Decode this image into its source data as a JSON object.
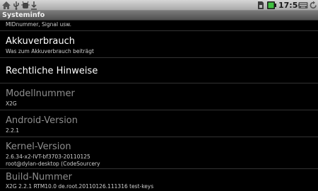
{
  "status_bar": {
    "time": "17:56",
    "icons": [
      "home-icon",
      "usb-icon",
      "usb-debugging-icon",
      "download-icon",
      "sim-icon",
      "battery-icon",
      "keyboard-icon",
      "rotate-icon"
    ]
  },
  "title_bar": {
    "title": "Systeminfo"
  },
  "items": [
    {
      "subtitle": "MIDnummer, Signal usw."
    },
    {
      "title": "Akkuverbrauch",
      "subtitle": "Was zum Akkuverbrauch beiträgt"
    },
    {
      "title": "Rechtliche Hinweise"
    },
    {
      "title": "Modellnummer",
      "subtitle": "X2G"
    },
    {
      "title": "Android-Version",
      "subtitle": "2.2.1"
    },
    {
      "title": "Kernel-Version",
      "subtitle": "2.6.34-x2-IVT-bf3703-20110125",
      "subtitle2": "root@dylan-desktop (CodeSourcery"
    },
    {
      "title": "Build-Nummer",
      "subtitle": "X2G 2.2.1 RTM10.0 de.root.20110126.111316 test-keys"
    }
  ],
  "colors": {
    "background": "#000000",
    "title_text": "#ffffff",
    "disabled_title_text": "#8e8e8e",
    "subtitle_text": "#cfcfcf"
  }
}
